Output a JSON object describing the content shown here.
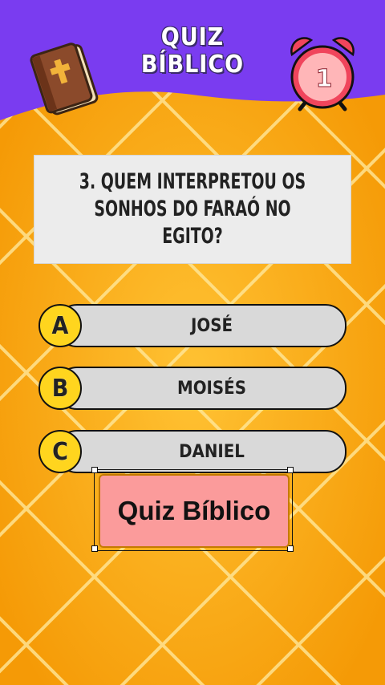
{
  "header": {
    "title_line1": "QUIZ",
    "title_line2": "BÍBLICO"
  },
  "timer": {
    "value": "1"
  },
  "question": {
    "text": "3. QUEM INTERPRETOU OS SONHOS DO FARAÓ NO EGITO?"
  },
  "answers": [
    {
      "letter": "A",
      "label": "JOSÉ"
    },
    {
      "letter": "B",
      "label": "MOISÉS"
    },
    {
      "letter": "C",
      "label": "DANIEL"
    }
  ],
  "sticker": {
    "text": "Quiz Bíblico"
  },
  "colors": {
    "header_purple": "#7a3cf0",
    "background_orange": "#f7a80a",
    "letter_yellow": "#ffd51e",
    "sticker_pink": "#fb9b9b",
    "clock_red": "#f0455c"
  }
}
